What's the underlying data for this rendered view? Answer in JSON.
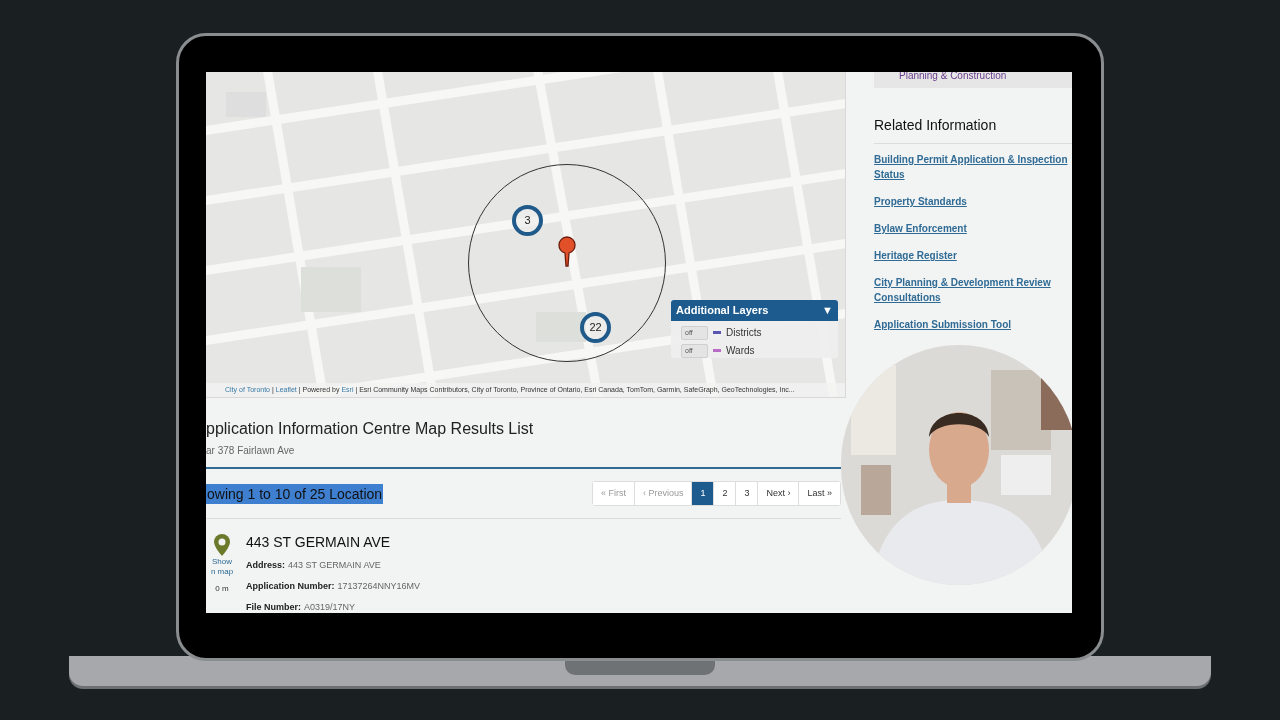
{
  "map": {
    "markers": [
      {
        "label": "3"
      },
      {
        "label": "22"
      }
    ],
    "attribution": [
      {
        "text": "City of Toronto",
        "link": true
      },
      {
        "text": " | ",
        "link": false
      },
      {
        "text": "Leaflet",
        "link": true
      },
      {
        "text": " | Powered by ",
        "link": false
      },
      {
        "text": "Esri",
        "link": true
      },
      {
        "text": " | Esri Community Maps Contributors, City of Toronto, Province of Ontario, Esri Canada, TomTom, Garmin, SafeGraph, GeoTechnologies, Inc...",
        "link": false
      }
    ],
    "layers_panel": {
      "title": "Additional Layers",
      "toggle": "▼",
      "layers": [
        {
          "switch": "off",
          "on": false,
          "name": "Districts",
          "color": "#5856b0"
        },
        {
          "switch": "off",
          "on": false,
          "name": "Wards",
          "color": "#b86cc8"
        }
      ]
    }
  },
  "results": {
    "title": "pplication Information Centre Map Results List",
    "subtitle": "ar 378 Fairlawn Ave",
    "summary": "owing 1 to 10 of 25 Location",
    "pagination": [
      {
        "label": "« First",
        "selected": false,
        "disabled": true
      },
      {
        "label": "‹ Previous",
        "selected": false,
        "disabled": true
      },
      {
        "label": "1",
        "selected": true,
        "disabled": false
      },
      {
        "label": "2",
        "selected": false,
        "disabled": false
      },
      {
        "label": "3",
        "selected": false,
        "disabled": false
      },
      {
        "label": "Next ›",
        "selected": false,
        "disabled": false
      },
      {
        "label": "Last »",
        "selected": false,
        "disabled": false
      }
    ],
    "item": {
      "show_on_map": "Show n map",
      "distance": "0 m",
      "title": "443 ST GERMAIN AVE",
      "fields": [
        {
          "label": "Address:",
          "value": "443 ST GERMAIN AVE"
        },
        {
          "label": "Application Number:",
          "value": "17137264NNY16MV"
        },
        {
          "label": "File Number:",
          "value": "A0319/17NY"
        }
      ]
    }
  },
  "sidebar": {
    "top_link": "Planning & Construction",
    "heading": "Related Information",
    "links": [
      "Building Permit Application & Inspection Status",
      "Property Standards",
      "Bylaw Enforcement",
      "Heritage Register",
      "City Planning & Development Review Consultations",
      "Application Submission Tool"
    ]
  }
}
